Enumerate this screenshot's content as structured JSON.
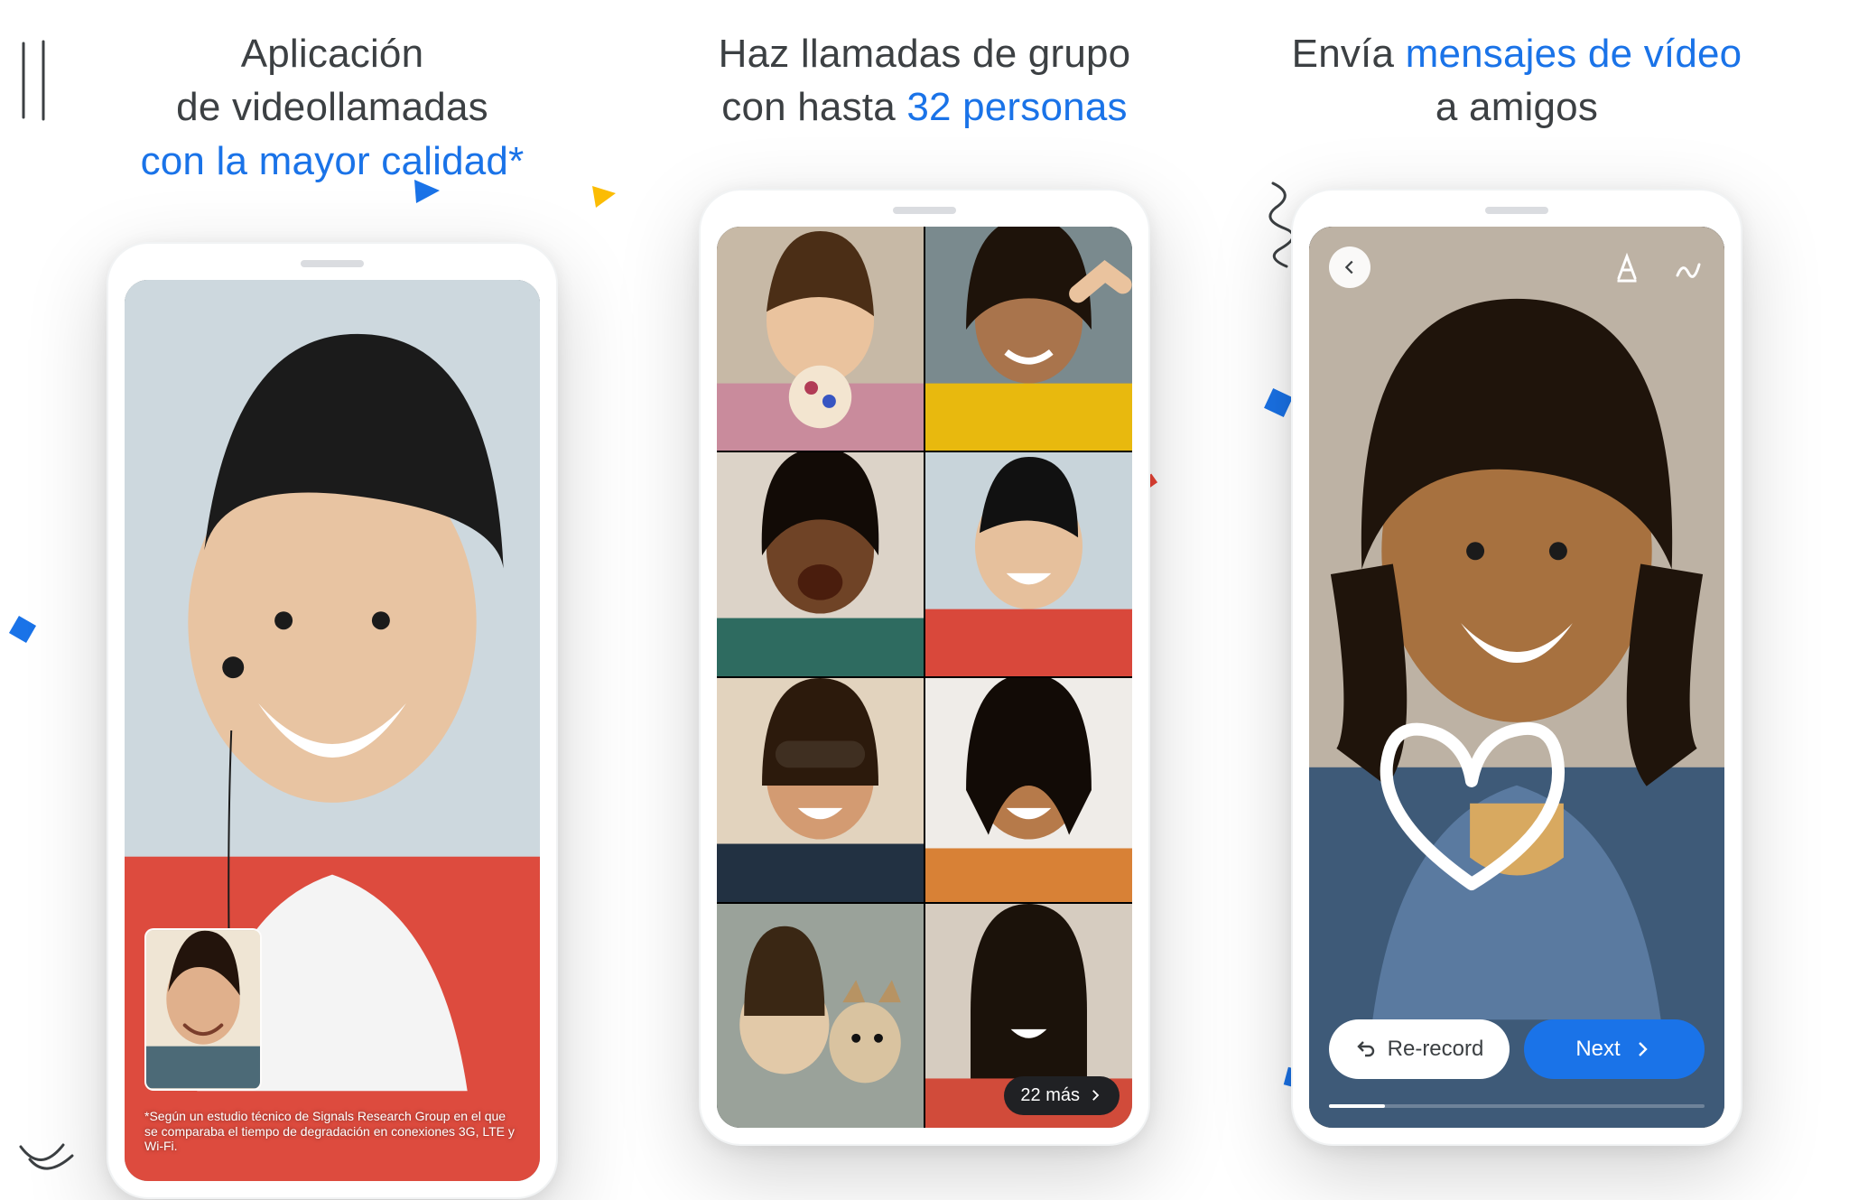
{
  "panel1": {
    "headline_line1": "Aplicación",
    "headline_line2": "de videollamadas",
    "headline_line3_blue": "con la mayor calidad*",
    "footnote": "*Según un estudio técnico de Signals Research Group en el que se comparaba el tiempo de degradación en conexiones 3G, LTE y Wi-Fi."
  },
  "panel2": {
    "headline_line1": "Haz llamadas de grupo",
    "headline_line2_plain": "con hasta ",
    "headline_line2_blue": "32 personas",
    "more_chip": "22 más"
  },
  "panel3": {
    "headline_line1_plain_a": "Envía ",
    "headline_line1_blue": "mensajes de vídeo",
    "headline_line2": "a amigos",
    "rerecord": "Re-record",
    "next": "Next"
  },
  "colors": {
    "blue": "#1a73e8",
    "red": "#ea4335",
    "yellow": "#fbbc04",
    "green": "#34a853"
  }
}
